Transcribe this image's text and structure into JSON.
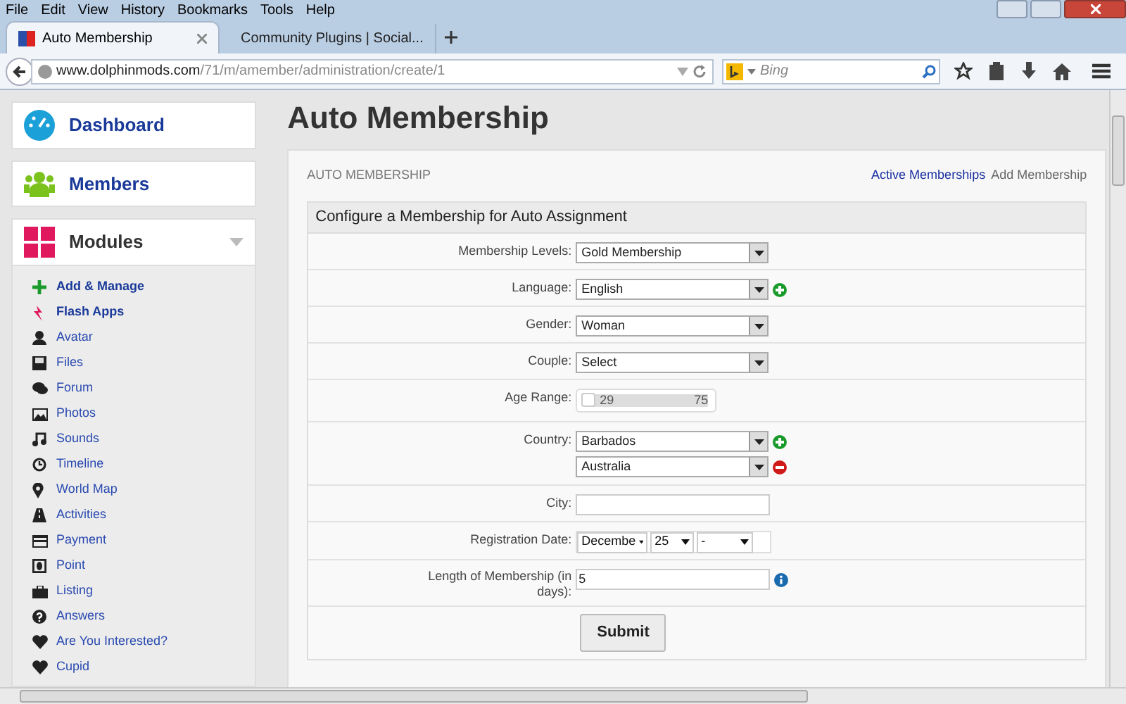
{
  "menu_bar": [
    "File",
    "Edit",
    "View",
    "History",
    "Bookmarks",
    "Tools",
    "Help"
  ],
  "tabs": [
    {
      "label": "Auto Membership",
      "selected": true
    },
    {
      "label": "Community Plugins | Social...",
      "selected": false
    }
  ],
  "address_bar": {
    "domain": "www.dolphinmods.com",
    "path": "/71/m/amember/administration/create/1"
  },
  "search": {
    "placeholder": "Bing"
  },
  "sidebar": {
    "cards": [
      {
        "label": "Dashboard",
        "kind": "dashboard"
      },
      {
        "label": "Members",
        "kind": "members"
      },
      {
        "label": "Modules",
        "kind": "modules",
        "expanded": true
      }
    ],
    "items": [
      {
        "label": "Add & Manage",
        "bold": true
      },
      {
        "label": "Flash Apps",
        "bold": true
      },
      {
        "label": "Avatar",
        "bold": false
      },
      {
        "label": "Files",
        "bold": false
      },
      {
        "label": "Forum",
        "bold": false
      },
      {
        "label": "Photos",
        "bold": false
      },
      {
        "label": "Sounds",
        "bold": false
      },
      {
        "label": "Timeline",
        "bold": false
      },
      {
        "label": "World Map",
        "bold": false
      },
      {
        "label": "Activities",
        "bold": false
      },
      {
        "label": "Payment",
        "bold": false
      },
      {
        "label": "Point",
        "bold": false
      },
      {
        "label": "Listing",
        "bold": false
      },
      {
        "label": "Answers",
        "bold": false
      },
      {
        "label": "Are You Interested?",
        "bold": false
      },
      {
        "label": "Cupid",
        "bold": false
      }
    ]
  },
  "page_title": "Auto Membership",
  "panel": {
    "heading": "AUTO MEMBERSHIP",
    "breadcrumbs": [
      {
        "label": "Active Memberships",
        "kind": "link"
      },
      {
        "label": "Add Membership",
        "kind": "current"
      }
    ]
  },
  "form": {
    "title": "Configure a Membership for Auto Assignment",
    "fields": [
      {
        "kind": "select",
        "label": "Membership Levels:",
        "values": [
          {
            "value": "Gold Membership",
            "addable": false,
            "removable": false
          }
        ]
      },
      {
        "kind": "select",
        "label": "Language:",
        "values": [
          {
            "value": "English",
            "addable": true,
            "removable": false
          }
        ]
      },
      {
        "kind": "select",
        "label": "Gender:",
        "values": [
          {
            "value": "Woman",
            "addable": false,
            "removable": false
          }
        ]
      },
      {
        "kind": "select",
        "label": "Couple:",
        "values": [
          {
            "value": "Select",
            "addable": false,
            "removable": false
          }
        ]
      },
      {
        "kind": "range",
        "label": "Age Range:",
        "low": "29",
        "high": "75",
        "level": 1
      },
      {
        "kind": "select",
        "label": "Country:",
        "values": [
          {
            "value": "Barbados",
            "addable": true,
            "removable": false
          },
          {
            "value": "Australia",
            "addable": false,
            "removable": true
          }
        ]
      },
      {
        "kind": "text",
        "label": "City:"
      },
      {
        "kind": "date",
        "label": "Registration Date:",
        "parts": [
          "Decembe",
          "25",
          "-"
        ]
      },
      {
        "kind": "text",
        "label": "Length of Membership (in days):",
        "value": "5",
        "info": true
      }
    ],
    "submit": "Submit"
  }
}
